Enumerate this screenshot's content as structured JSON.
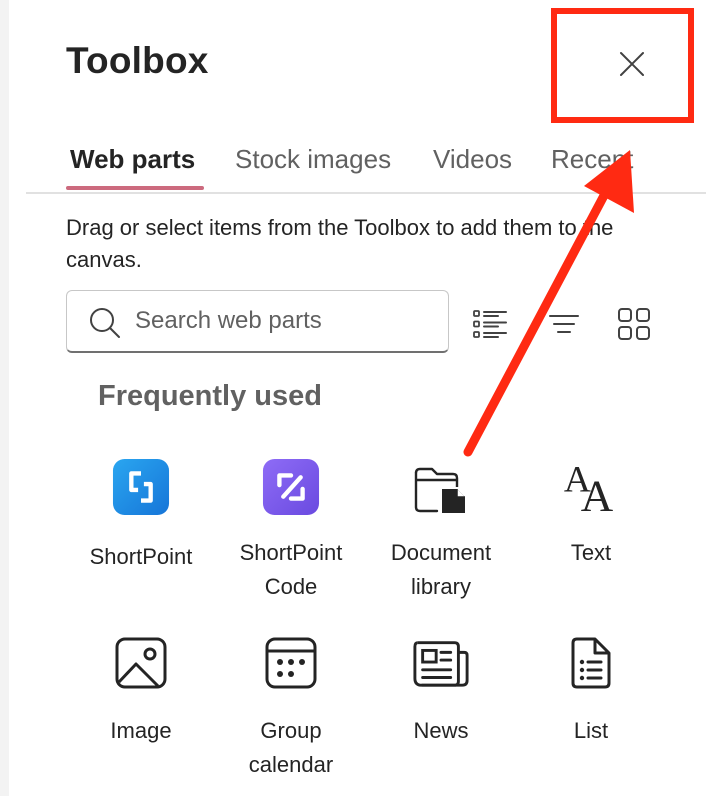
{
  "panel": {
    "title": "Toolbox",
    "close_icon": "close-icon"
  },
  "tabs": [
    {
      "label": "Web parts",
      "active": true
    },
    {
      "label": "Stock images",
      "active": false
    },
    {
      "label": "Videos",
      "active": false
    },
    {
      "label": "Recent",
      "active": false
    }
  ],
  "description": "Drag or select items from the Toolbox to add them to the canvas.",
  "search": {
    "placeholder": "Search web parts",
    "value": ""
  },
  "view_controls": [
    "list-view-icon",
    "sort-icon",
    "grid-view-icon"
  ],
  "section": {
    "heading": "Frequently used",
    "items": [
      {
        "label": "ShortPoint",
        "icon": "shortpoint-logo-icon"
      },
      {
        "label": "ShortPoint\nCode",
        "icon": "shortpoint-code-logo-icon"
      },
      {
        "label": "Document\nlibrary",
        "icon": "document-library-icon"
      },
      {
        "label": "Text",
        "icon": "text-icon"
      },
      {
        "label": "Image",
        "icon": "image-icon"
      },
      {
        "label": "Group\ncalendar",
        "icon": "group-calendar-icon"
      },
      {
        "label": "News",
        "icon": "news-icon"
      },
      {
        "label": "List",
        "icon": "list-icon"
      }
    ]
  },
  "colors": {
    "annotation_red": "#ff2a12",
    "tab_underline": "#cc6a7e",
    "shortpoint_blue": "#1a8fe3",
    "shortpoint_code_purple": "#7b5cf0"
  }
}
